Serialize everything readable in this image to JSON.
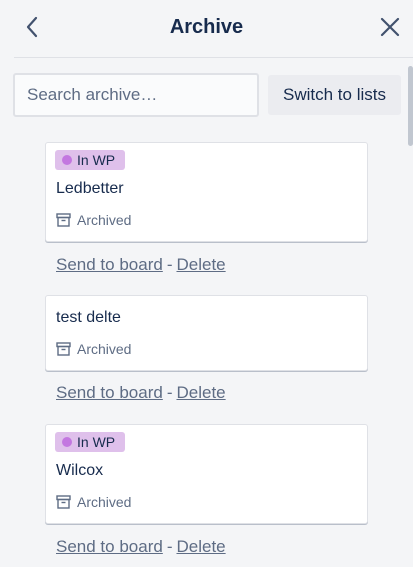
{
  "header": {
    "title": "Archive",
    "back_icon": "chevron-left-icon",
    "close_icon": "close-icon"
  },
  "search": {
    "placeholder": "Search archive…",
    "value": ""
  },
  "switch_button": {
    "label": "Switch to lists"
  },
  "colors": {
    "label_bg": "#dfc0eb",
    "label_dot": "#c377e0",
    "link": "#5e6c84",
    "background": "#f4f5f7"
  },
  "cards": [
    {
      "label": "In WP",
      "title": "Ledbetter",
      "badge": "Archived",
      "send_link": "Send to board",
      "separator": "-",
      "delete_link": "Delete"
    },
    {
      "label": "",
      "title": "test delte",
      "badge": "Archived",
      "send_link": "Send to board",
      "separator": "-",
      "delete_link": "Delete"
    },
    {
      "label": "In WP",
      "title": "Wilcox",
      "badge": "Archived",
      "send_link": "Send to board",
      "separator": "-",
      "delete_link": "Delete"
    }
  ]
}
